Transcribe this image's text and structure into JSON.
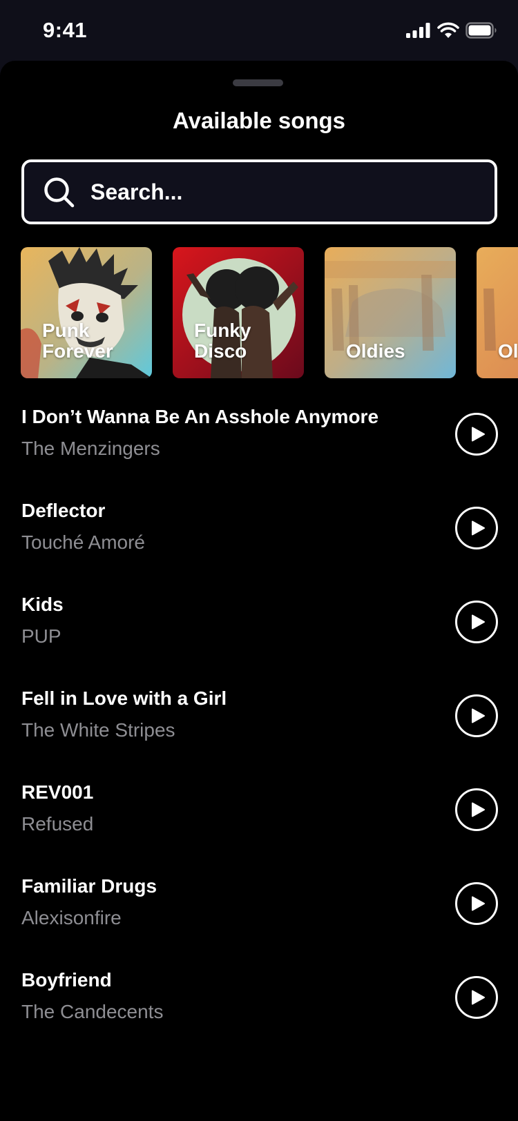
{
  "status_bar": {
    "time": "9:41",
    "icons": [
      "cellular-signal-icon",
      "wifi-icon",
      "battery-icon"
    ]
  },
  "sheet": {
    "title": "Available songs"
  },
  "search": {
    "placeholder": "Search...",
    "icon": "search-icon"
  },
  "playlists": [
    {
      "label": "Punk\nForever",
      "art": "punk-forever-art"
    },
    {
      "label": "Funky\nDisco",
      "art": "funky-disco-art"
    },
    {
      "label": "Oldies",
      "art": "oldies-art"
    },
    {
      "label": "Ol",
      "art": "oldies-art"
    }
  ],
  "songs": [
    {
      "title": "I Don’t Wanna Be An Asshole Anymore",
      "artist": "The Menzingers"
    },
    {
      "title": "Deflector",
      "artist": "Touché Amoré"
    },
    {
      "title": "Kids",
      "artist": "PUP"
    },
    {
      "title": "Fell in Love with a Girl",
      "artist": "The White Stripes"
    },
    {
      "title": "REV001",
      "artist": "Refused"
    },
    {
      "title": "Familiar Drugs",
      "artist": "Alexisonfire"
    },
    {
      "title": "Boyfriend",
      "artist": "The Candecents"
    }
  ],
  "colors": {
    "background": "#000000",
    "status_bar_bg": "#0f0f19",
    "text_primary": "#ffffff",
    "text_secondary": "#8e8e93",
    "grabber": "#3b3b42"
  }
}
